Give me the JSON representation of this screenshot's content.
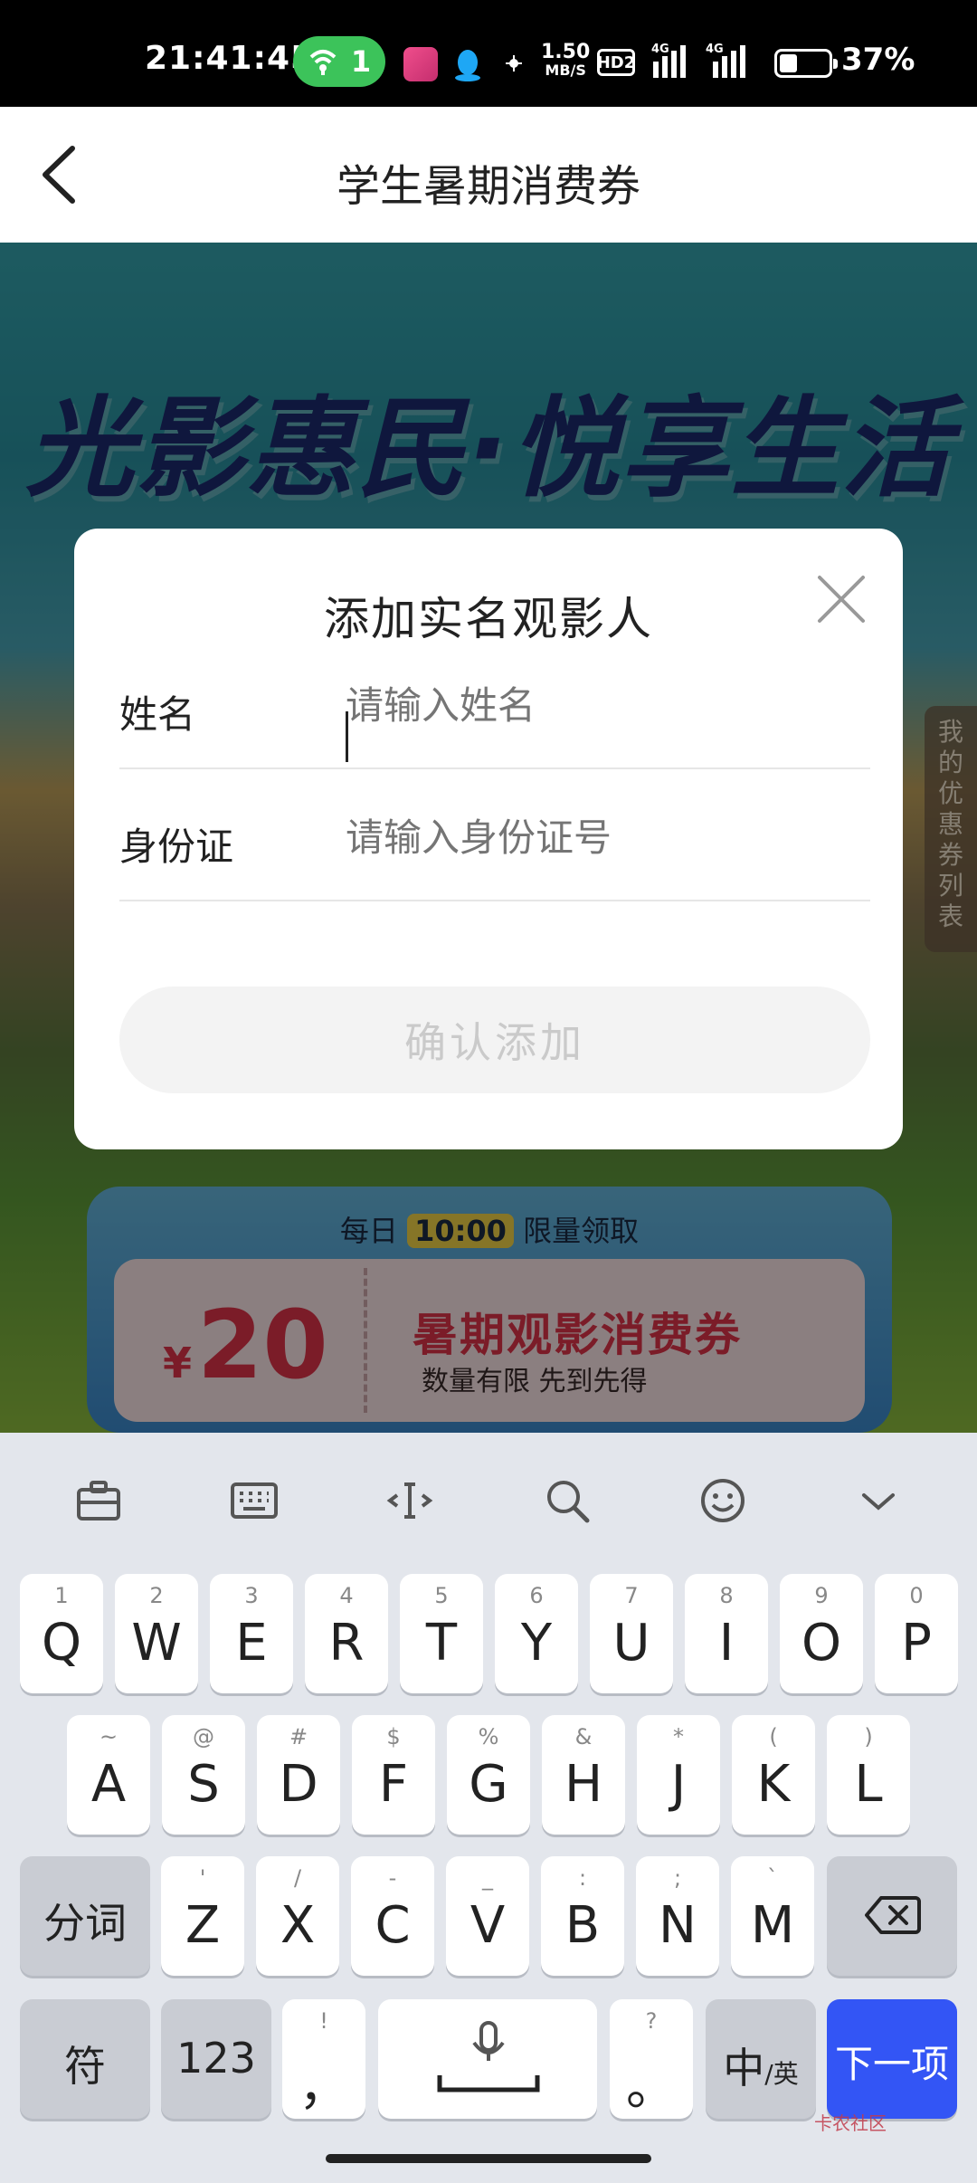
{
  "status_bar": {
    "time": "21:41:45",
    "hotspot_count": "1",
    "net_speed_value": "1.50",
    "net_speed_unit": "MB/S",
    "hd_label": "HD2",
    "signal1_label": "4G",
    "signal2_label": "4G",
    "battery_percent": "37%",
    "battery_level": 0.37
  },
  "header": {
    "title": "学生暑期消费券"
  },
  "background": {
    "slogan": "光影惠民·悦享生活",
    "side_tab_chars": [
      "我",
      "的",
      "优",
      "惠",
      "券",
      "列",
      "表"
    ],
    "coupon": {
      "head_prefix": "每日",
      "head_time": "10:00",
      "head_suffix": "限量领取",
      "currency": "¥",
      "amount": "20",
      "name": "暑期观影消费券",
      "subtitle": "数量有限 先到先得"
    }
  },
  "modal": {
    "title": "添加实名观影人",
    "name_label": "姓名",
    "name_placeholder": "请输入姓名",
    "id_label": "身份证",
    "id_placeholder": "请输入身份证号",
    "confirm_label": "确认添加"
  },
  "keyboard": {
    "toolbar_icons": [
      "clipboard-icon",
      "keyboard-icon",
      "cursor-move-icon",
      "search-icon",
      "emoji-icon",
      "chevron-down-icon"
    ],
    "row1": [
      {
        "main": "Q",
        "sub": "1"
      },
      {
        "main": "W",
        "sub": "2"
      },
      {
        "main": "E",
        "sub": "3"
      },
      {
        "main": "R",
        "sub": "4"
      },
      {
        "main": "T",
        "sub": "5"
      },
      {
        "main": "Y",
        "sub": "6"
      },
      {
        "main": "U",
        "sub": "7"
      },
      {
        "main": "I",
        "sub": "8"
      },
      {
        "main": "O",
        "sub": "9"
      },
      {
        "main": "P",
        "sub": "0"
      }
    ],
    "row2": [
      {
        "main": "A",
        "sub": "~"
      },
      {
        "main": "S",
        "sub": "@"
      },
      {
        "main": "D",
        "sub": "#"
      },
      {
        "main": "F",
        "sub": "$"
      },
      {
        "main": "G",
        "sub": "%"
      },
      {
        "main": "H",
        "sub": "&"
      },
      {
        "main": "J",
        "sub": "*"
      },
      {
        "main": "K",
        "sub": "("
      },
      {
        "main": "L",
        "sub": ")"
      }
    ],
    "row3_left": "分词",
    "row3": [
      {
        "main": "Z",
        "sub": "'"
      },
      {
        "main": "X",
        "sub": "/"
      },
      {
        "main": "C",
        "sub": "-"
      },
      {
        "main": "V",
        "sub": "_"
      },
      {
        "main": "B",
        "sub": ":"
      },
      {
        "main": "N",
        "sub": ";"
      },
      {
        "main": "M",
        "sub": "`"
      }
    ],
    "symbols_label": "符",
    "numbers_label": "123",
    "comma_main": "，",
    "comma_sub": "!",
    "period_main": "。",
    "period_sub": "?",
    "lang_main": "中",
    "lang_sub": "/英",
    "next_label": "下一项"
  },
  "watermark": "卡农社区"
}
